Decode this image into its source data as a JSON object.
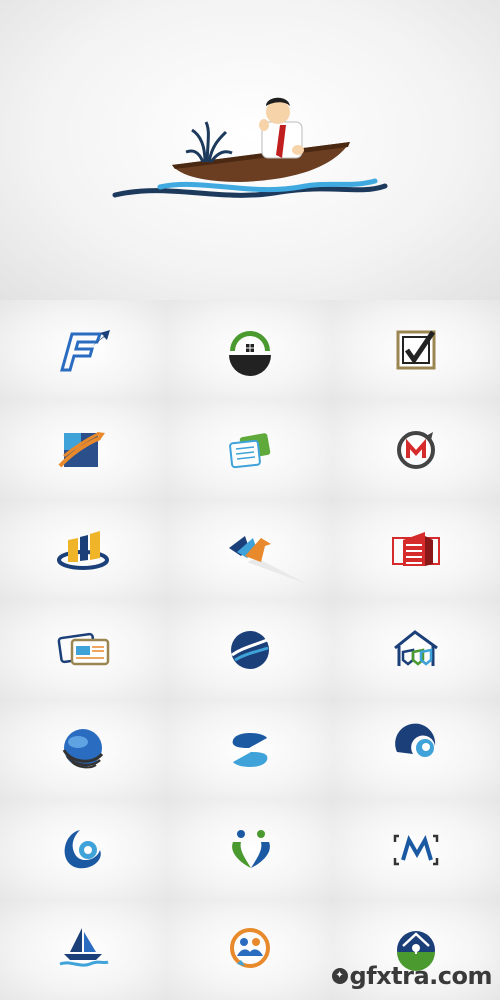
{
  "watermark": {
    "text": "gfxtra.com",
    "icon": "gfxtra-logo-icon"
  },
  "colors": {
    "navy": "#1b3f78",
    "blue": "#2a6cc0",
    "sky": "#3fa2d8",
    "orange": "#e8892b",
    "green": "#4a9a2f",
    "red": "#d62b2b",
    "gold": "#9b8550"
  },
  "logos": [
    "hero-man-in-boat",
    "letter-f-arrow",
    "house-green-roof",
    "checkbox-check",
    "square-orange-arrows",
    "green-documents",
    "circle-letter-m",
    "yellow-bars-ring",
    "orange-arrow-chevrons",
    "red-building",
    "id-cards",
    "blue-globe-wave",
    "house-shields",
    "sphere-stripes",
    "blue-letter-s",
    "blue-swirl-circle",
    "blue-swirl-c",
    "green-heart-people",
    "letter-m-brackets",
    "sailboat-waves",
    "orange-people-circle",
    "green-house-lock"
  ]
}
